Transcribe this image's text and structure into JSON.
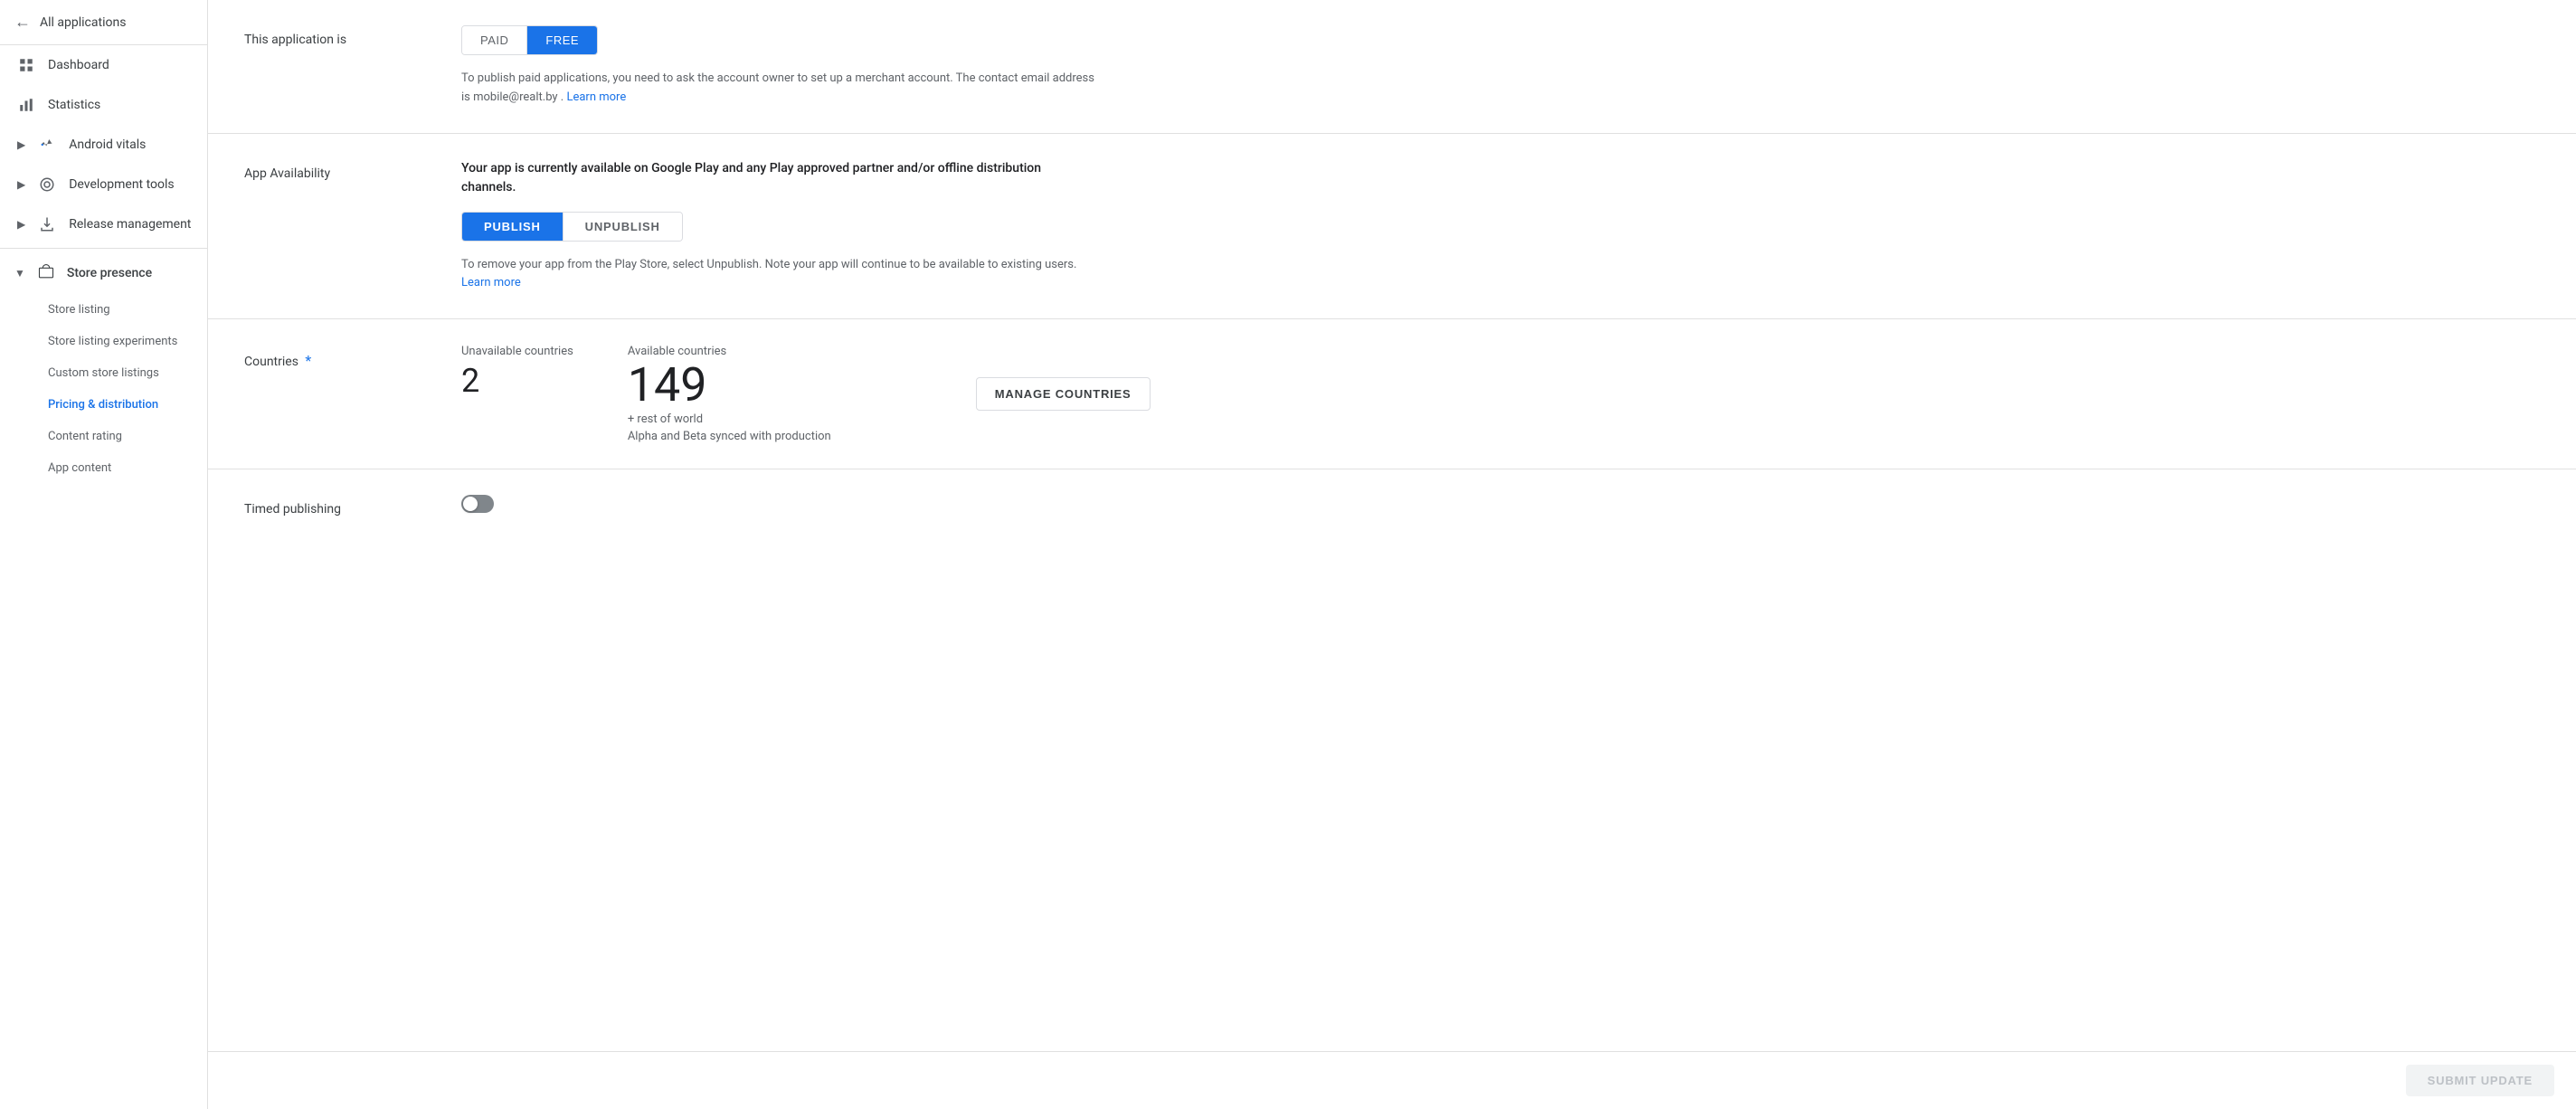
{
  "sidebar": {
    "back_label": "All applications",
    "items": [
      {
        "id": "dashboard",
        "label": "Dashboard",
        "icon": "⊞"
      },
      {
        "id": "statistics",
        "label": "Statistics",
        "icon": "▦"
      },
      {
        "id": "android-vitals",
        "label": "Android vitals",
        "icon": "∿",
        "has_chevron": true
      },
      {
        "id": "development-tools",
        "label": "Development tools",
        "icon": "⚙",
        "has_chevron": true
      },
      {
        "id": "release-management",
        "label": "Release management",
        "icon": "⬆",
        "has_chevron": true
      }
    ],
    "store_presence": {
      "label": "Store presence",
      "icon": "🛍",
      "sub_items": [
        {
          "id": "store-listing",
          "label": "Store listing"
        },
        {
          "id": "store-listing-experiments",
          "label": "Store listing experiments"
        },
        {
          "id": "custom-store-listings",
          "label": "Custom store listings"
        },
        {
          "id": "pricing-distribution",
          "label": "Pricing & distribution",
          "active": true
        },
        {
          "id": "content-rating",
          "label": "Content rating"
        },
        {
          "id": "app-content",
          "label": "App content"
        }
      ]
    }
  },
  "main": {
    "app_type": {
      "label": "This application is",
      "paid_label": "PAID",
      "free_label": "FREE",
      "active": "FREE",
      "description": "To publish paid applications, you need to ask the account owner to set up a merchant account. The contact email address is mobile@realt.by .",
      "learn_more": "Learn more"
    },
    "availability": {
      "label": "App Availability",
      "description": "Your app is currently available on Google Play and any Play approved partner and/or offline distribution channels.",
      "publish_label": "PUBLISH",
      "unpublish_label": "UNPUBLISH",
      "active": "PUBLISH",
      "note": "To remove your app from the Play Store, select Unpublish. Note your app will continue to be available to existing users.",
      "learn_more": "Learn more"
    },
    "countries": {
      "label": "Countries",
      "required": true,
      "unavailable_label": "Unavailable countries",
      "unavailable_count": "2",
      "available_label": "Available countries",
      "available_count": "149",
      "rest_of_world": "+ rest of world",
      "sync_note": "Alpha and Beta synced with production",
      "manage_label": "MANAGE COUNTRIES"
    },
    "timed_publishing": {
      "label": "Timed publishing",
      "enabled": false
    },
    "submit_label": "SUBMIT UPDATE"
  }
}
